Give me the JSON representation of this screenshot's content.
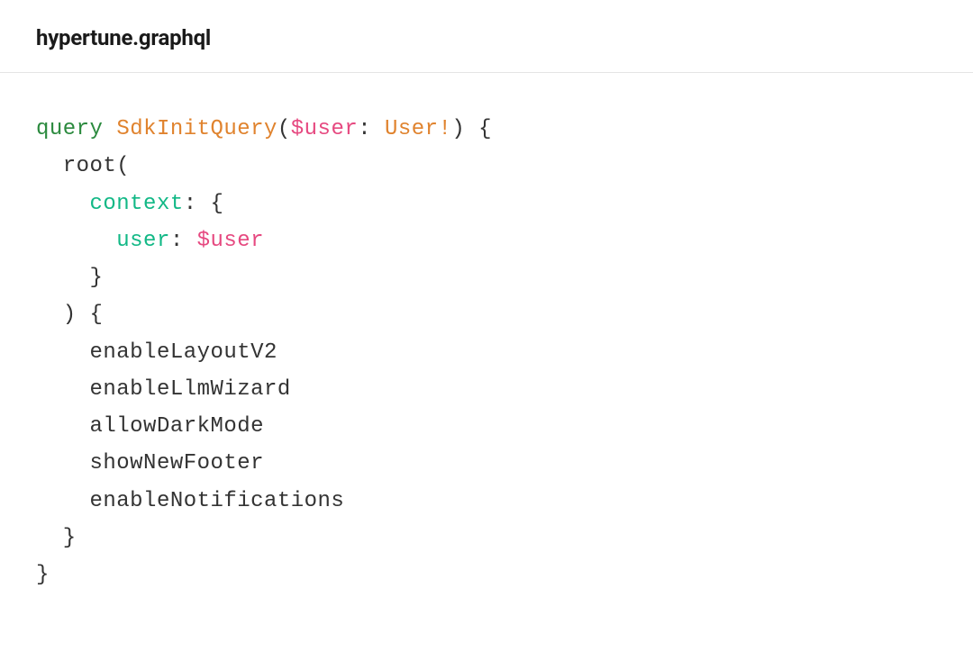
{
  "filename": "hypertune.graphql",
  "code": {
    "line1": {
      "keyword": "query",
      "space": " ",
      "opname": "SdkInitQuery",
      "paren_open": "(",
      "var": "$user",
      "colon": ": ",
      "type": "User!",
      "paren_close": ")",
      "brace_open": " {"
    },
    "line2": {
      "indent": "  ",
      "func": "root",
      "paren_open": "("
    },
    "line3": {
      "indent": "    ",
      "field": "context",
      "colon_brace": ": {"
    },
    "line4": {
      "indent": "      ",
      "field": "user",
      "colon": ": ",
      "var": "$user"
    },
    "line5": {
      "indent": "    ",
      "brace_close": "}"
    },
    "line6": {
      "indent": "  ",
      "paren_close_brace": ") {"
    },
    "line7": {
      "indent": "    ",
      "name": "enableLayoutV2"
    },
    "line8": {
      "indent": "    ",
      "name": "enableLlmWizard"
    },
    "line9": {
      "indent": "    ",
      "name": "allowDarkMode"
    },
    "line10": {
      "indent": "    ",
      "name": "showNewFooter"
    },
    "line11": {
      "indent": "    ",
      "name": "enableNotifications"
    },
    "line12": {
      "indent": "  ",
      "brace": "}"
    },
    "line13": {
      "brace": "}"
    }
  }
}
